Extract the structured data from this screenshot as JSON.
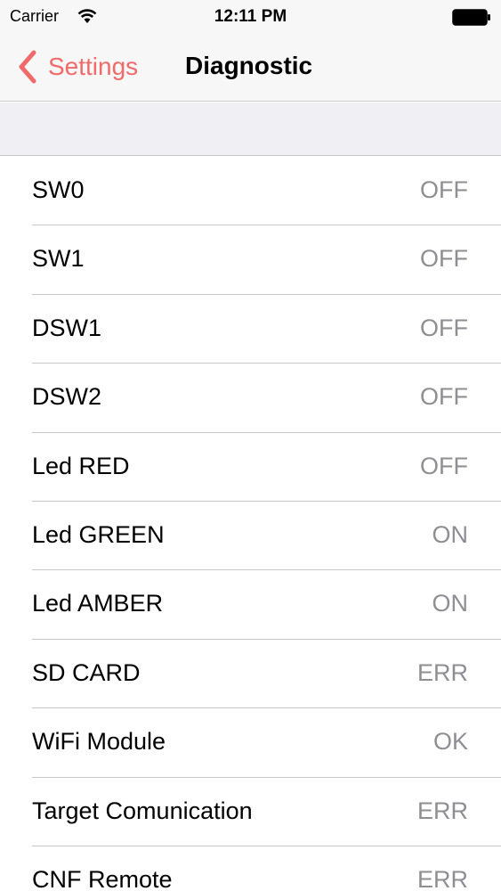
{
  "status_bar": {
    "carrier": "Carrier",
    "time": "12:11 PM"
  },
  "nav": {
    "back_label": "Settings",
    "title": "Diagnostic",
    "accent_color": "#f06a6a"
  },
  "rows": [
    {
      "label": "SW0",
      "value": "OFF"
    },
    {
      "label": "SW1",
      "value": "OFF"
    },
    {
      "label": "DSW1",
      "value": "OFF"
    },
    {
      "label": "DSW2",
      "value": "OFF"
    },
    {
      "label": "Led RED",
      "value": "OFF"
    },
    {
      "label": "Led GREEN",
      "value": "ON"
    },
    {
      "label": "Led AMBER",
      "value": "ON"
    },
    {
      "label": "SD CARD",
      "value": "ERR"
    },
    {
      "label": "WiFi Module",
      "value": "OK"
    },
    {
      "label": "Target Comunication",
      "value": "ERR"
    },
    {
      "label": "CNF Remote",
      "value": "ERR"
    }
  ]
}
